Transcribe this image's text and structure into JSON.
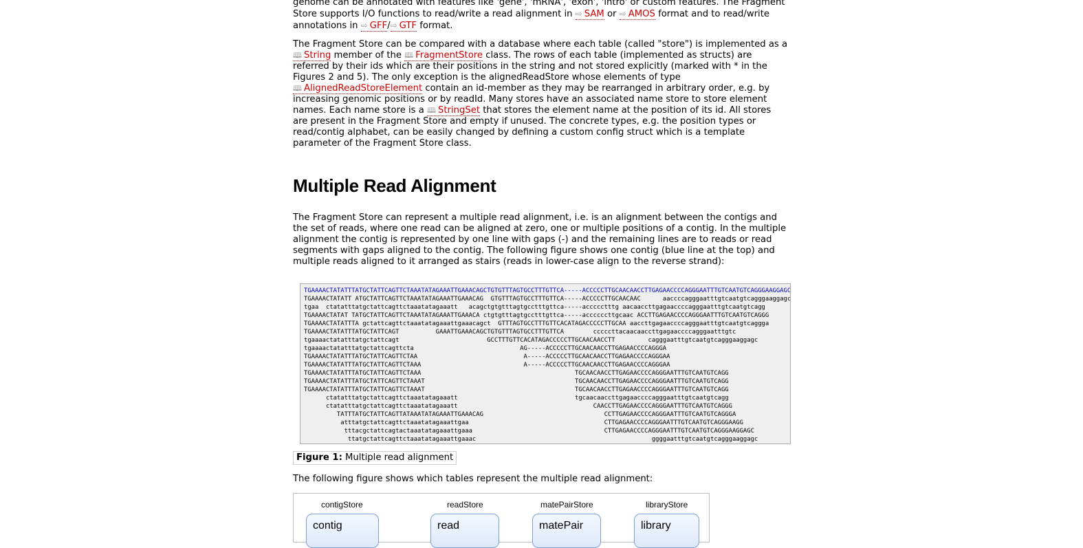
{
  "intro_end": {
    "line1": "genome can be annotated with features like 'gene', 'mRNA', 'exon', 'intro' or custom features. The Fragment",
    "line2_a": "Store supports I/O functions to read/write a read alignment in ",
    "link_sam": "SAM",
    "line2_b": " or ",
    "link_amos": "AMOS",
    "line2_c": " format and to read/write",
    "line3_a": "annotations in ",
    "link_gff": "GFF",
    "slash": "/",
    "link_gtf": "GTF",
    "line3_b": " format."
  },
  "para2": {
    "t1": "The Fragment Store can be compared with a database where each table (called \"store\") is implemented as a",
    "link_string": "String",
    "t2": " member of the ",
    "link_fragmentstore": "FragmentStore",
    "t3": " class. The rows of each table (implemented as structs) are",
    "t4": "referred by their ids which are their positions in the string and not stored explicitly (marked with * in the",
    "t5": "Figures 2 and 5). The only exception is the alignedReadStore whose elements of type",
    "link_aligned": "AlignedReadStoreElement",
    "t6": " contain an id-member as they may be rearranged in arbitrary order, e.g. by",
    "t7": "increasing genomic positions or by readId. Many stores have an associated name store to store element",
    "t8": "names. Each name store is a ",
    "link_stringset": "StringSet",
    "t9": " that stores the element name at the position of its id. All stores",
    "t10": "are present in the Fragment Store and empty if unused. The concrete types, e.g. the position types or",
    "t11": "read/contig alphabet, can be easily changed by defining a custom config struct which is a template",
    "t12": "parameter of the Fragment Store class."
  },
  "heading": "Multiple Read Alignment",
  "para3": {
    "l1": "The Fragment Store can represent a multiple read alignment, i.e. is an alignment between the contigs and",
    "l2": "the set of reads, where one read can be aligned at zero, one or multiple positions of a contig. In the multiple",
    "l3": "alignment the contig is represented by one line with gaps (-) and the remaining lines are to reads or read",
    "l4": "segments with gaps aligned to the contig. The following figure shows one contig (blue line at the top) and",
    "l5": "multiple reads aligned to it arranged as stairs (reads in lower-case align to the reverse strand):"
  },
  "alignment": {
    "l0": "TGAAAACTATATTTATGCTATTCAGTTCTAAATATAGAAATTGAAACAGCTGTGTTTAGTGCCTTTGTTCA-----ACCCCCTTGCAACAACCTTGAGAACCCCAGGGAATTTGTCAATGTCAGGGAAGGAGC",
    "l1": "TGAAAACTATATT ATGCTATTCAGTTCTAAATATAGAAATTGAAACAG  GTGTTTAGTGCCTTTGTTCA-----ACCCCCTTGCAACAAC      aaccccagggaatttgtcaatgtcagggaaggagc",
    "l2": "tgaa  ctatatttatgctattcagttctaaatatagaaatt   acagctgtgtttagtgcctttgttca-----accccctttg aacaaccttgagaaccccagggaatttgtcaatgtcagg",
    "l3": "TGAAAACTATAT TATGCTATTCAGTTCTAAATATAGAAATTGAAACA ctgtgtttagtgcctttgttca-----accccccttgcaac ACCTTGAGAACCCCAGGGAATTTGTCAATGTCAGGG",
    "l4": "TGAAAACTATATTTA gctattcagttctaaatatagaaattgaaacagct  GTTTAGTGCCTTTGTTCACATAGACCCCCTTGCAA aaccttgagaaccccagggaatttgtcaatgtcaggga",
    "l5": "TGAAAACTATATTTATGCTATTCAGT          GAAATTGAAACAGCTGTGTTTAGTGCCTTTGTTCA        cccccttacaacaaccttgagaaccccagggaatttgtc",
    "l6": "tgaaaactatatttatgctattcagt                        GCCTTTGTTCACATAGACCCCCTTGCAACAACCTT         cagggaatttgtcaatgtcagggaaggagc",
    "l7": "tgaaaactatatttatgctattcagttcta                             AG-----ACCCCCTTGCAACAACCTTGAGAACCCCAGGGA",
    "l8": "TGAAAACTATATTTATGCTATTCAGTTCTAA                             A-----ACCCCCTTGCAACAACCTTGAGAACCCCAGGGAA",
    "l9": "TGAAAACTATATTTATGCTATTCAGTTCTAAA                            A-----ACCCCCTTGCAACAACCTTGAGAACCCCAGGGAA",
    "l10": "TGAAAACTATATTTATGCTATTCAGTTCTAAA                                          TGCAACAACCTTGAGAACCCCAGGGAATTTGTCAATGTCAGG",
    "l11": "TGAAAACTATATTTATGCTATTCAGTTCTAAAT                                         TGCAACAACCTTGAGAACCCCAGGGAATTTGTCAATGTCAGG",
    "l12": "TGAAAACTATATTTATGCTATTCAGTTCTAAAT                                         TGCAACAACCTTGAGAACCCCAGGGAATTTGTCAATGTCAGG",
    "l13": "      ctatatttatgctattcagttctaaatatagaaatt                                tgcaacaaccttgagaaccccagggaatttgtcaatgtcagg",
    "l14": "      ctatatttatgctattcagttctaaatatagaaatt                                     CAACCTTGAGAACCCCAGGGAATTTGTCAATGTCAGGG",
    "l15": "         TATTTATGCTATTCAGTTATAAATATAGAAATTGAAACAG                                 CCTTGAGAACCCCAGGGAATTTGTCAATGTCAGGGA",
    "l16": "          atttatgctattcagttctaaatatagaaattgaa                                     CTTGAGAACCCCAGGGAATTTGTCAATGTCAGGGAAGG",
    "l17": "           tttacgctattcagtactaaatatagaaattgaaa                                    CTTGAGAACCCCAGGGAATTTGTCAATGTCAGGGAAGGAGC",
    "l18": "            ttatgctattcagttctaaatatagaaattgaaac                                                ggggaatttgtcaatgtcagggaaggagc"
  },
  "figure_caption": {
    "label": "Figure 1:",
    "text": " Multiple read alignment"
  },
  "para4": "The following figure shows which tables represent the multiple read alignment:",
  "diagram": {
    "tables": [
      {
        "title": "contigStore",
        "box": "contig"
      },
      {
        "title": "readStore",
        "box": "read"
      },
      {
        "title": "matePairStore",
        "box": "matePair"
      },
      {
        "title": "libraryStore",
        "box": "library"
      }
    ]
  }
}
